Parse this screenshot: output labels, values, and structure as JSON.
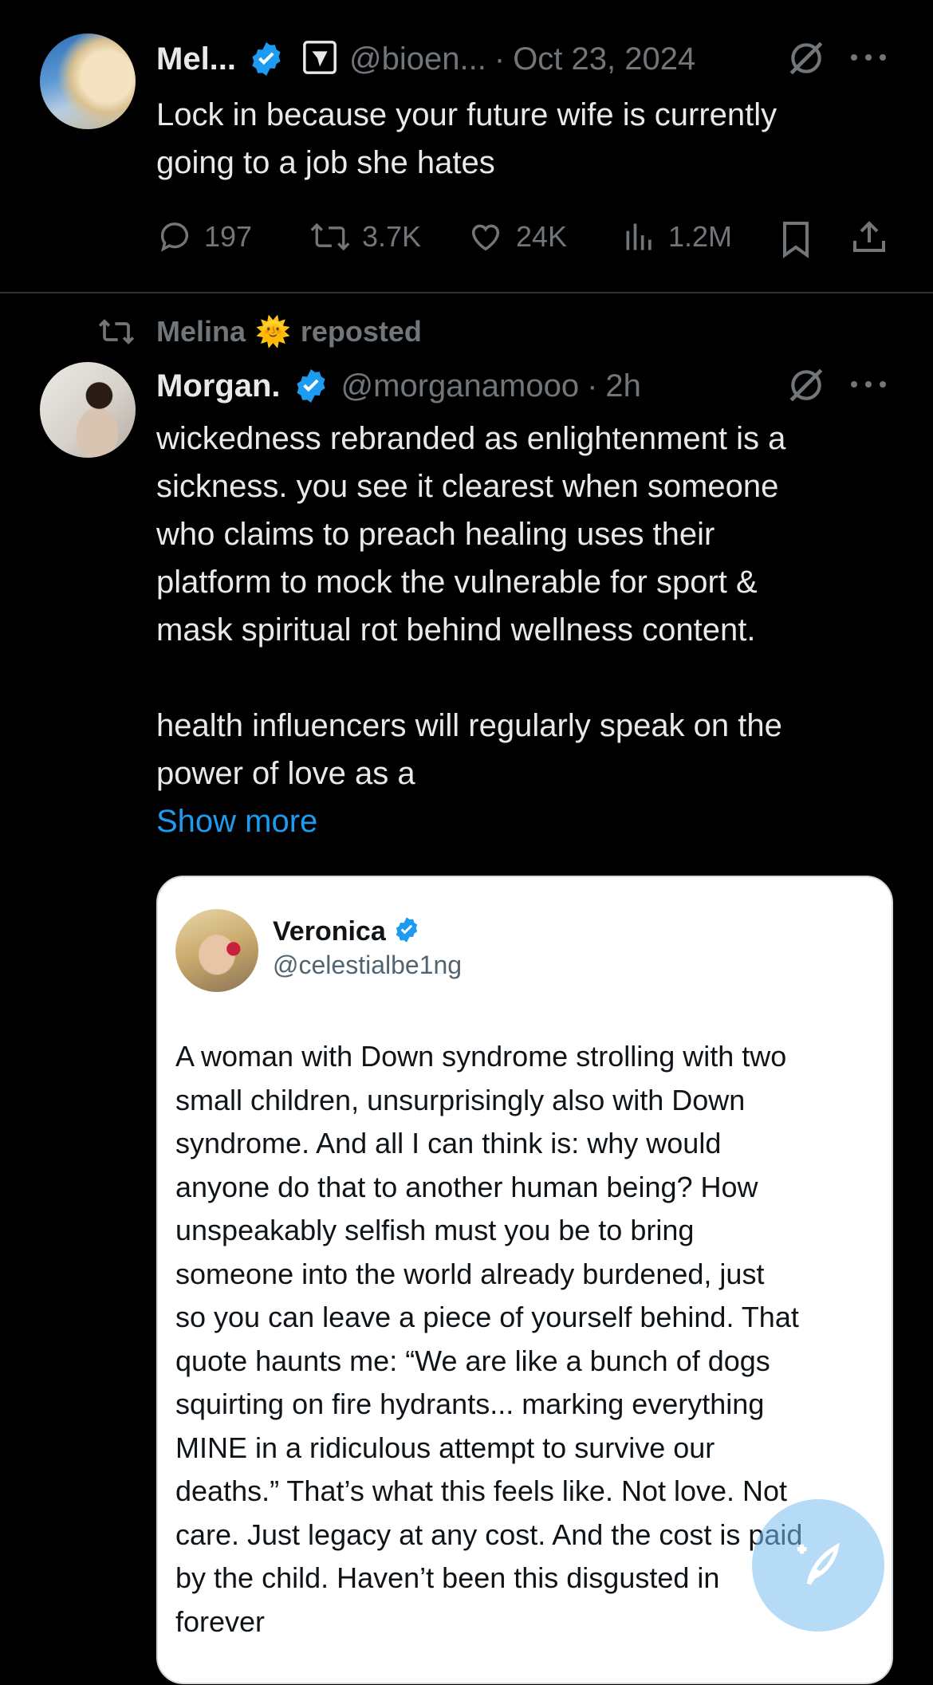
{
  "tweet1": {
    "name": "Mel...",
    "handle": "@bioen...",
    "sep": "·",
    "date": "Oct 23, 2024",
    "text_lines": [
      "Lock in because your future wife is currently",
      "going to a job she hates"
    ],
    "replies": "197",
    "reposts": "3.7K",
    "likes": "24K",
    "views": "1.2M"
  },
  "repost_banner": {
    "name": "Melina",
    "emoji": "🌞",
    "label": "reposted"
  },
  "tweet2": {
    "name": "Morgan.",
    "handle": "@morganamooo",
    "sep": "·",
    "time": "2h",
    "text_lines": [
      "wickedness rebranded as enlightenment is a",
      "sickness. you see it clearest when someone",
      "who claims to preach healing uses their",
      "platform to mock the vulnerable for sport &",
      "mask spiritual rot behind wellness content.",
      "",
      "health influencers will regularly speak on the",
      "power of love as a"
    ],
    "show_more": "Show more"
  },
  "embedded": {
    "name": "Veronica",
    "handle": "@celestialbe1ng",
    "text_lines": [
      "A woman with Down syndrome strolling with two",
      "small children, unsurprisingly also with Down",
      "syndrome. And all I can think is: why would",
      "anyone do that to another human being? How",
      "unspeakably selfish must you be to bring",
      "someone into the world already burdened, just",
      "so you can leave a piece of yourself behind. That",
      "quote haunts me: “We are like a bunch of dogs",
      "squirting on fire hydrants... marking everything",
      "MINE in a ridiculous attempt to survive our",
      "deaths.” That’s what this feels like. Not love. Not",
      "care. Just legacy at any cost. And the cost is paid",
      "by the child. Haven’t been this disgusted in",
      "forever"
    ]
  },
  "icons": {
    "verified": "verified-badge-icon",
    "affiliate": "affiliate-badge-icon",
    "grok": "grok-icon",
    "more": "more-icon",
    "reply": "reply-icon",
    "repost": "repost-icon",
    "like": "like-icon",
    "views": "views-icon",
    "bookmark": "bookmark-icon",
    "share": "share-icon",
    "compose": "compose-icon"
  },
  "colors": {
    "background": "#000000",
    "text": "#e7e9ea",
    "muted": "#71767b",
    "link": "#1d9bf0",
    "verified": "#1d9bf0"
  }
}
